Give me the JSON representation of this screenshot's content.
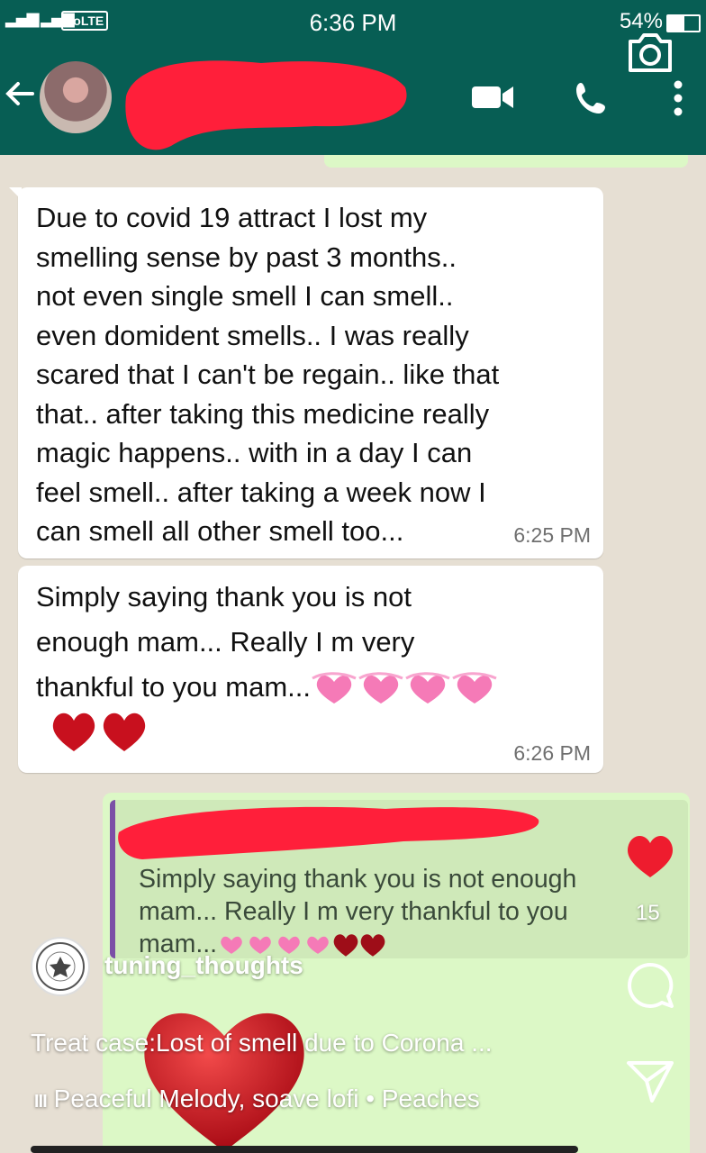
{
  "status_bar": {
    "network": "4G",
    "volte": "VoLTE",
    "time": "6:36 PM",
    "battery": "54%",
    "battery_level": 0.54
  },
  "header": {
    "icons": [
      "back-arrow-icon",
      "video-call-icon",
      "phone-icon",
      "more-icon",
      "camera-icon"
    ]
  },
  "messages": [
    {
      "text": "Due to covid 19 attract I lost my\nsmelling sense by past 3 months..\nnot even single smell I can smell..\neven domident smells.. I was really\nscared that I can't be regain.. like that\nthat.. after taking this medicine really\nmagic happens.. with in a day I can\nfeel smell.. after taking a week now I\ncan smell all other smell too...",
      "time": "6:25 PM"
    },
    {
      "text": "Simply saying thank you is not\nenough mam... Really I m very\nthankful to you mam...",
      "time": "6:26 PM"
    }
  ],
  "reply": {
    "quoted_text": "Simply saying thank you is not enough mam... Really I m very thankful to you mam..."
  },
  "post": {
    "account": "tuning_thoughts",
    "likes": "15",
    "caption": "Treat case:Lost of smell due to Corona ...",
    "music": "Peaceful Melody, soave lofi • Peaches"
  },
  "colors": {
    "header": "#075e54",
    "incoming": "#ffffff",
    "outgoing": "#dcf8c6",
    "redaction": "#ff1f3a",
    "like": "#ee1c2e"
  }
}
